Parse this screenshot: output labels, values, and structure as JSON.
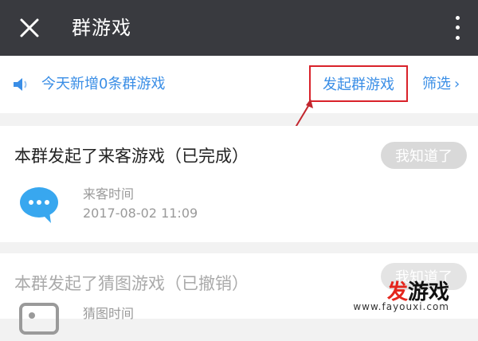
{
  "header": {
    "title": "群游戏",
    "close_icon": "close-icon",
    "more_icon": "more-vertical-icon"
  },
  "notice": {
    "speaker_icon": "speaker-icon",
    "text": "今天新增0条群游戏",
    "start_button": "发起群游戏",
    "filter_label": "筛选",
    "filter_chevron": "›"
  },
  "cards": [
    {
      "title": "本群发起了来客游戏（已完成）",
      "ack_label": "我知道了",
      "icon": "chat-bubble-icon",
      "meta_label": "来客时间",
      "meta_time": "2017-08-02 11:09"
    },
    {
      "title": "本群发起了猜图游戏（已撤销）",
      "ack_label": "我知道了",
      "icon": "image-game-icon",
      "meta_label": "猜图时间"
    }
  ],
  "watermark": {
    "main_accent": "发",
    "main_rest": "游戏",
    "sub": "www.fayouxi.com"
  },
  "colors": {
    "titlebar": "#393a3f",
    "link_blue": "#3a8ee6",
    "highlight_red": "#d9222a",
    "button_gray": "#d9d9d9"
  }
}
